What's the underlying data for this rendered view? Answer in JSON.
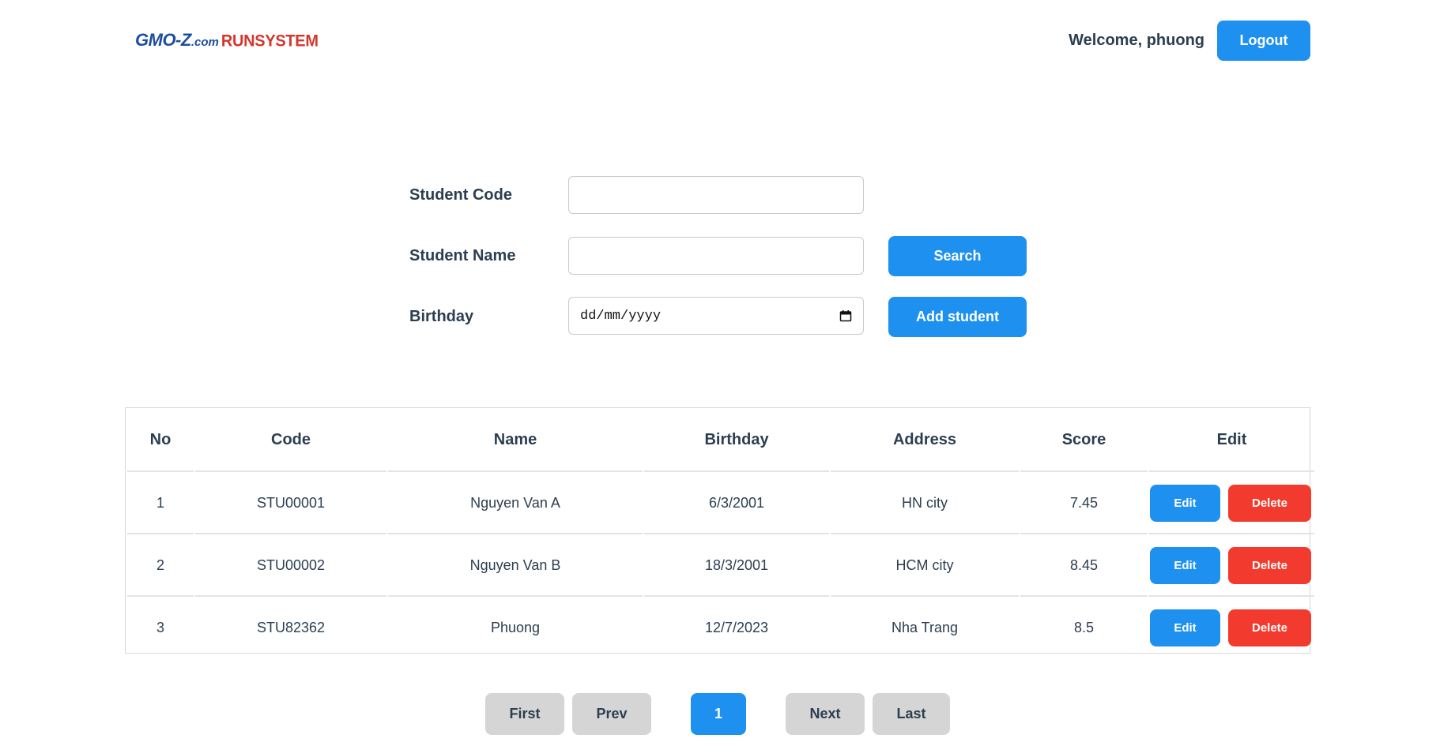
{
  "header": {
    "logo": {
      "part1": "GMO-Z",
      "part2": ".com",
      "part3": "RUNSYSTEM"
    },
    "welcome": "Welcome, phuong",
    "logout_label": "Logout"
  },
  "search": {
    "code_label": "Student Code",
    "code_value": "",
    "name_label": "Student Name",
    "name_value": "",
    "birthday_label": "Birthday",
    "birthday_placeholder": "dd/mm/yyyy",
    "search_label": "Search",
    "add_label": "Add student"
  },
  "table": {
    "headers": [
      "No",
      "Code",
      "Name",
      "Birthday",
      "Address",
      "Score",
      "Edit"
    ],
    "rows": [
      {
        "no": "1",
        "code": "STU00001",
        "name": "Nguyen Van A",
        "birthday": "6/3/2001",
        "address": "HN city",
        "score": "7.45"
      },
      {
        "no": "2",
        "code": "STU00002",
        "name": "Nguyen Van B",
        "birthday": "18/3/2001",
        "address": "HCM city",
        "score": "8.45"
      },
      {
        "no": "3",
        "code": "STU82362",
        "name": "Phuong",
        "birthday": "12/7/2023",
        "address": "Nha Trang",
        "score": "8.5"
      }
    ],
    "edit_label": "Edit",
    "delete_label": "Delete"
  },
  "pagination": {
    "first": "First",
    "prev": "Prev",
    "current": "1",
    "next": "Next",
    "last": "Last"
  },
  "colors": {
    "primary": "#1e90f0",
    "danger": "#f23a2e",
    "neutral": "#d5d5d5",
    "text": "#2c3e50"
  }
}
